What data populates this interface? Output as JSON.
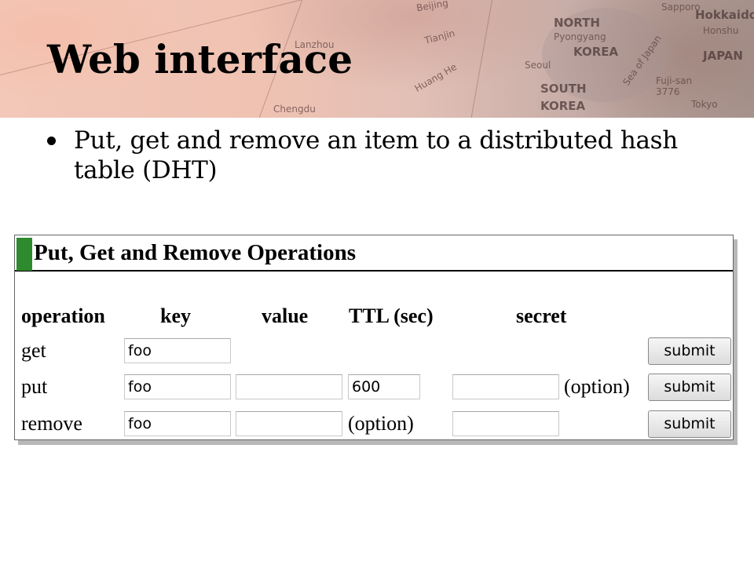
{
  "slide": {
    "title": "Web interface",
    "bullet": "Put, get and remove an item to a distributed hash table (DHT)"
  },
  "banner": {
    "map_labels": [
      "Beijing",
      "Tianjin",
      "NORTH",
      "Pyongyang",
      "KOREA",
      "Seoul",
      "SOUTH",
      "KOREA",
      "Sea of Japan",
      "Sapporo",
      "Hokkaido",
      "Honshu",
      "JAPAN",
      "Fuji-san",
      "3776",
      "Tokyo",
      "Chengdu",
      "Lanzhou",
      "Huang He"
    ]
  },
  "panel": {
    "title": "Put, Get and Remove Operations",
    "columns": [
      "operation",
      "key",
      "value",
      "TTL (sec)",
      "secret"
    ],
    "rows": [
      {
        "operation": "get",
        "key": "foo",
        "submit": "submit"
      },
      {
        "operation": "put",
        "key": "foo",
        "value": "",
        "ttl": "600",
        "secret": "",
        "note": "(option)",
        "submit": "submit"
      },
      {
        "operation": "remove",
        "key": "foo",
        "value": "",
        "note": "(option)",
        "secret": "",
        "submit": "submit"
      }
    ]
  },
  "colors": {
    "accent": "#2d8a2d",
    "banner": "#efc2b2"
  }
}
